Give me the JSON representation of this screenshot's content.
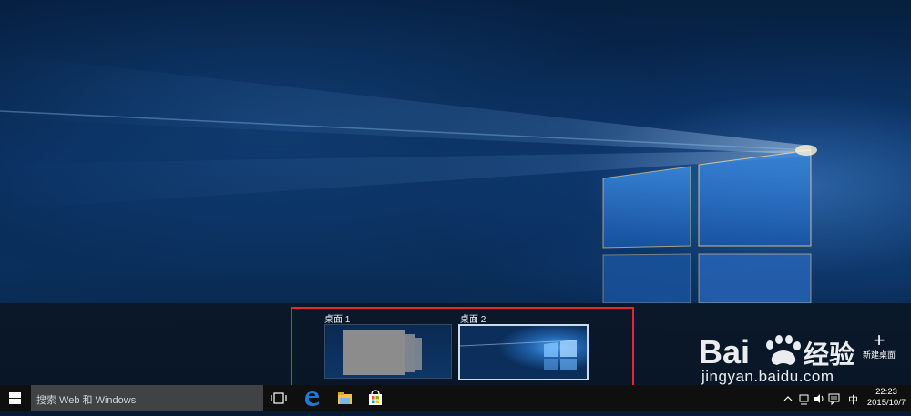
{
  "task_view": {
    "desktops": [
      {
        "label": "桌面 1"
      },
      {
        "label": "桌面 2"
      }
    ],
    "new_desktop_label": "新建桌面",
    "new_desktop_symbol": "+"
  },
  "taskbar": {
    "search_placeholder": "搜索 Web 和 Windows",
    "pinned_icons": [
      "task-view-icon",
      "edge-icon",
      "file-explorer-icon",
      "store-icon"
    ],
    "tray": {
      "input_method": "中",
      "time": "22:23",
      "date": "2015/10/7"
    }
  },
  "watermark": {
    "brand": "Bai du 经验",
    "url": "jingyan.baidu.com"
  },
  "colors": {
    "highlight": "#e0282e",
    "taskbar": "#0f0f10",
    "search_bg": "#404346",
    "edge_blue": "#1e78d6"
  }
}
